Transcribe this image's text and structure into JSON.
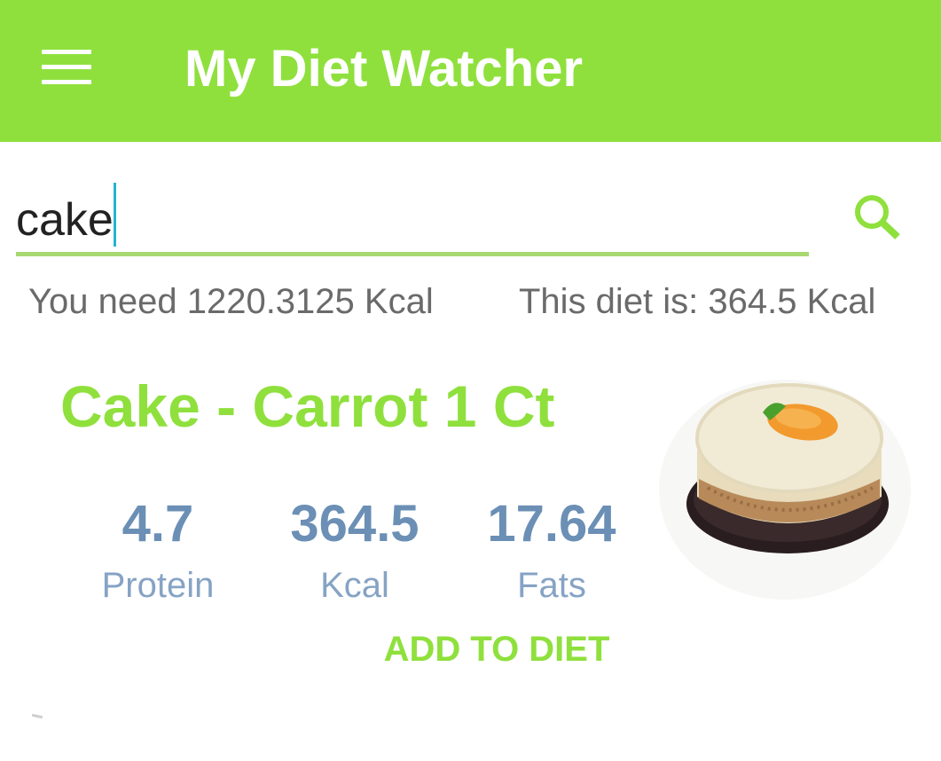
{
  "app": {
    "title": "My Diet Watcher",
    "accent_color": "#8fe03d",
    "menu_icon": "hamburger-menu-icon"
  },
  "search": {
    "value": "cake",
    "placeholder": "",
    "icon": "search-icon"
  },
  "summary": {
    "need_text": "You need 1220.3125 Kcal",
    "diet_text": "This diet is: 364.5 Kcal"
  },
  "food": {
    "name": "Cake - Carrot 1 Ct",
    "image": "carrot-cake-image",
    "stats": {
      "protein": {
        "value": "4.7",
        "label": "Protein"
      },
      "kcal": {
        "value": "364.5",
        "label": "Kcal"
      },
      "fats": {
        "value": "17.64",
        "label": "Fats"
      }
    },
    "stat_value_color": "#6b8fb5",
    "add_label": "ADD TO DIET"
  }
}
